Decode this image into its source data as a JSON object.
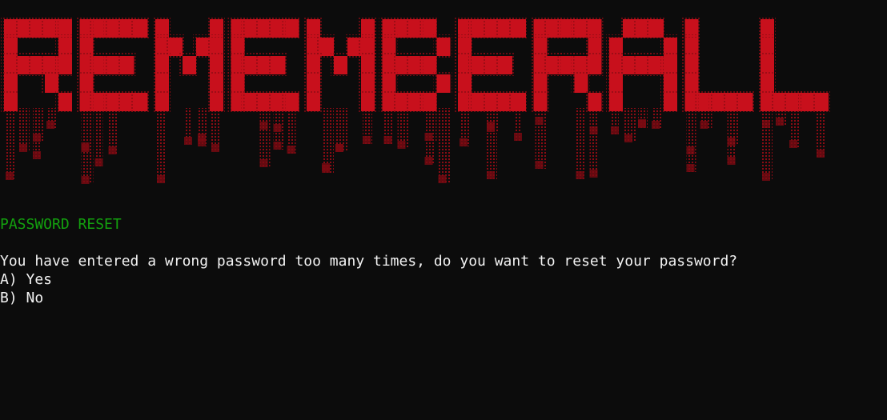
{
  "banner": {
    "logo_text": "REMEMBERALL",
    "primary_color": "#c8101c",
    "drip_color": "#7a0a12"
  },
  "screen": {
    "title": "PASSWORD RESET",
    "title_color": "#13a10e",
    "text_color": "#f2f2f2",
    "background": "#0c0c0c",
    "prompt": "You have entered a wrong password too many times, do you want to reset your password?",
    "options": [
      {
        "label": "A) Yes"
      },
      {
        "label": "B) No"
      }
    ]
  }
}
